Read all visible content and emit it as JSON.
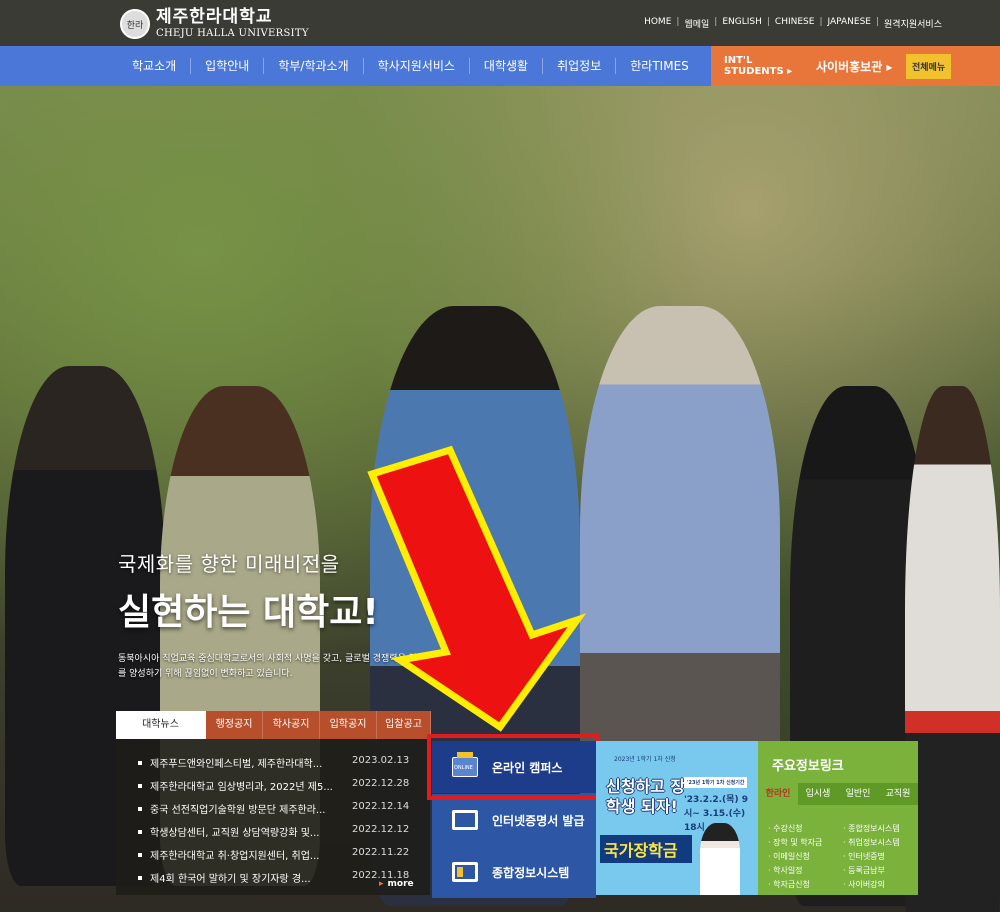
{
  "header": {
    "logo_kr": "제주한라대학교",
    "logo_en": "CHEJU HALLA UNIVERSITY",
    "logo_seal": "한라",
    "util_links": [
      "HOME",
      "웹메일",
      "ENGLISH",
      "CHINESE",
      "JAPANESE",
      "원격지원서비스"
    ]
  },
  "nav": {
    "items": [
      "학교소개",
      "입학안내",
      "학부/학과소개",
      "학사지원서비스",
      "대학생활",
      "취업정보",
      "한라TIMES"
    ],
    "intl": "INT'L STUDENTS ▸",
    "cyber": "사이버홍보관 ▸",
    "allmenu": "전체메뉴"
  },
  "hero": {
    "line1": "국제화를 향한 미래비전을",
    "line2": "실현하는 대학교!",
    "desc": "동북아시아 직업교육 중심대학교로서의 사회적 사명을 갖고, 글로벌 경쟁력을 갖춘 인재를 양성하기 위해 끊임없이 변화하고 있습니다."
  },
  "news": {
    "tabs": [
      "대학뉴스",
      "행정공지",
      "학사공지",
      "입학공지",
      "입찰공고"
    ],
    "items": [
      {
        "title": "제주푸드앤와인페스티벌, 제주한라대학...",
        "date": "2023.02.13"
      },
      {
        "title": "제주한라대학교 임상병리과, 2022년 제5...",
        "date": "2022.12.28"
      },
      {
        "title": "중국 선전직업기술학원 방문단 제주한라...",
        "date": "2022.12.14"
      },
      {
        "title": "학생상담센터, 교직원 상담역량강화 및...",
        "date": "2022.12.12"
      },
      {
        "title": "제주한라대학교 취·창업지원센터, 취업...",
        "date": "2022.11.22"
      },
      {
        "title": "제4회 한국어 말하기 및 장기자랑 경...",
        "date": "2022.11.18"
      }
    ],
    "more": "more"
  },
  "services": {
    "online": "온라인 캠퍼스",
    "online_icon_text": "ONLINE",
    "cert": "인터넷증명서 발급",
    "info": "종합정보시스템"
  },
  "banner": {
    "tag": "2023년 1학기 1차 신청",
    "line1": "신청하고 장학생 되자!",
    "date_badge": "'23년 1학기 1차 신청기간",
    "dates": "'23.2.2.(목) 9시~ 3.15.(수) 18시",
    "line3": "국가장학금"
  },
  "info_links": {
    "title": "주요정보링크",
    "tabs": [
      "한라인",
      "입시생",
      "일반인",
      "교직원"
    ],
    "links": [
      "수강신청",
      "종합정보시스템",
      "장학 및 학자금",
      "취업정보시스템",
      "이메일신청",
      "인터넷증명",
      "학사일정",
      "등록금납부",
      "학자금신청",
      "사이버강의"
    ]
  },
  "colors": {
    "nav_blue": "#4b78d8",
    "nav_orange": "#e8753a",
    "news_tab": "#b84f2c",
    "service_blue": "#2d56a4",
    "info_green": "#7ab23c",
    "highlight_red": "#e01c1c",
    "arrow_red": "#ee1111",
    "arrow_outline": "#ffee00"
  }
}
